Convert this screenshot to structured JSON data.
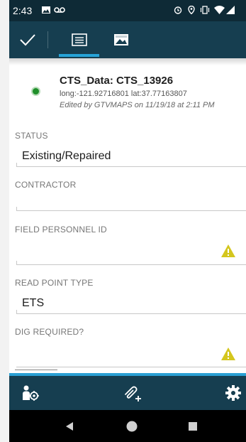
{
  "status_bar": {
    "time": "2:43",
    "icons": [
      "image-icon",
      "voicemail-icon",
      "alarm-icon",
      "location-icon",
      "vibrate-icon",
      "wifi-icon",
      "signal-icon"
    ]
  },
  "toolbar": {
    "save_icon": "check-icon",
    "tabs": [
      {
        "name": "attributes-tab",
        "icon": "form-icon",
        "selected": true
      },
      {
        "name": "media-tab",
        "icon": "image-gallery-icon",
        "selected": false
      }
    ],
    "accent": "#26a3d8",
    "background": "#163e50"
  },
  "feature": {
    "title": "CTS_Data: CTS_13926",
    "coords": "long:-121.92716801 lat:37.77163807",
    "edited": "Edited by GTVMAPS on 11/19/18 at 2:11 PM",
    "marker_color": "#1f8f2a"
  },
  "fields": [
    {
      "label": "STATUS",
      "value": "Existing/Repaired",
      "warning": false
    },
    {
      "label": "CONTRACTOR",
      "value": "",
      "warning": false
    },
    {
      "label": "FIELD PERSONNEL ID",
      "value": "",
      "warning": true
    },
    {
      "label": "READ POINT TYPE",
      "value": "ETS",
      "warning": false
    },
    {
      "label": "DIG REQUIRED?",
      "value": "",
      "warning": true
    }
  ],
  "bottom_bar": {
    "buttons": [
      "person-location-icon",
      "attachment-add-icon",
      "settings-icon"
    ]
  },
  "nav_bar": {
    "buttons": [
      "back-icon",
      "home-icon",
      "recents-icon"
    ]
  },
  "warning_color": "#d4c61e"
}
